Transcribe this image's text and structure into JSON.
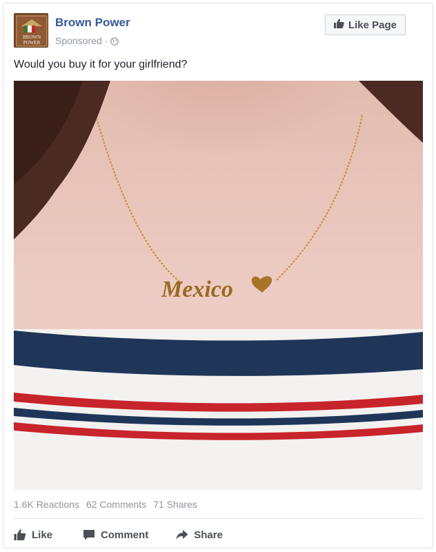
{
  "post": {
    "page_name": "Brown Power",
    "avatar_text_1": "BROWN",
    "avatar_text_2": "POWER",
    "sponsored_label": "Sponsored",
    "dot": "·",
    "like_page_label": "Like Page",
    "caption": "Would you buy it for your girlfriend?",
    "photo_text": "Mexico",
    "stats": {
      "reactions": "1.6K Reactions",
      "comments": "62 Comments",
      "shares": "71 Shares"
    },
    "actions": {
      "like": "Like",
      "comment": "Comment",
      "share": "Share"
    }
  },
  "colors": {
    "page_name": "#365899",
    "muted": "#90949c",
    "button_text": "#4b4f56"
  },
  "icons": [
    "globe-icon",
    "thumbs-up-icon",
    "comment-icon",
    "share-icon"
  ]
}
